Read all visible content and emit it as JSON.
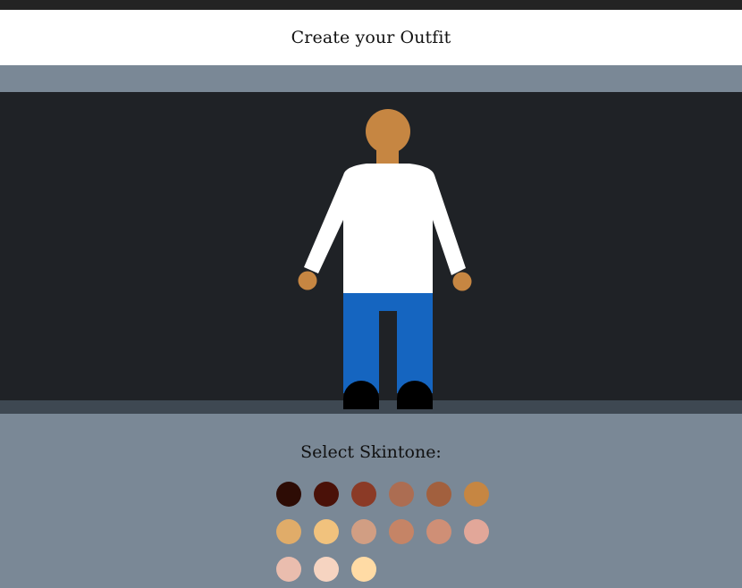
{
  "header": {
    "title": "Create your Outfit"
  },
  "figure": {
    "skin_color": "#c68642",
    "shirt_color": "#ffffff",
    "pants_color": "#1565c0",
    "shoe_color": "#000000"
  },
  "skintone_picker": {
    "title": "Select Skintone:",
    "options": [
      "#2d0c05",
      "#4a1108",
      "#8b3a26",
      "#ac6d52",
      "#a2603e",
      "#c68642",
      "#e0ac69",
      "#f1c27d",
      "#d19e83",
      "#c58466",
      "#cf8f76",
      "#e2a799",
      "#eabdae",
      "#f6d4c1",
      "#ffdba5"
    ]
  }
}
